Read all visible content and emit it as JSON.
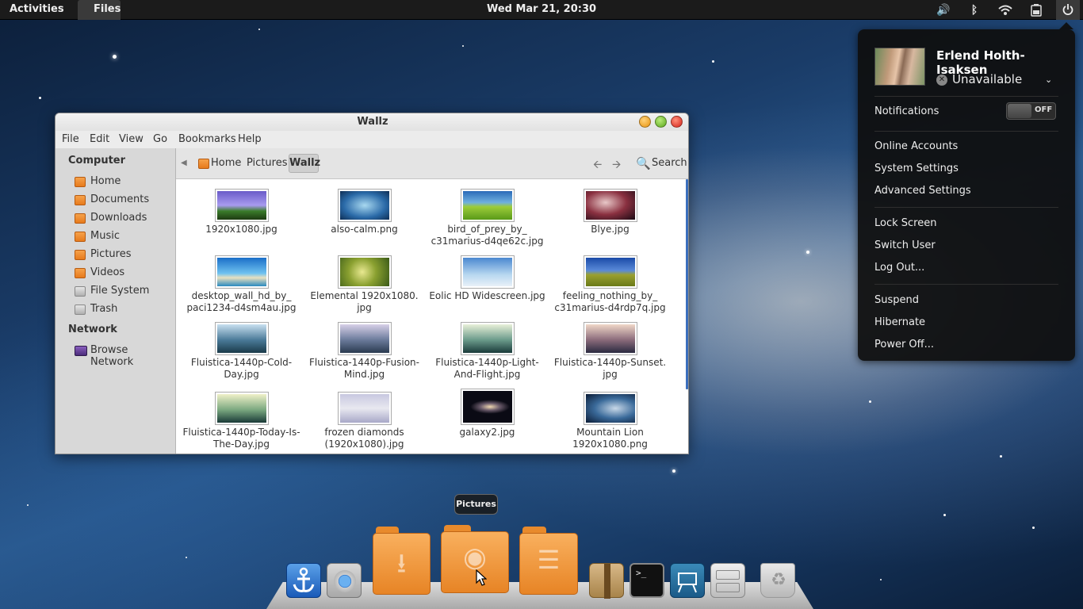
{
  "topbar": {
    "activities": "Activities",
    "app_menu": "Files",
    "clock": "Wed Mar 21, 20:30",
    "tray_icons": [
      "volume-icon",
      "bluetooth-icon",
      "wifi-icon",
      "battery-icon",
      "power-icon"
    ]
  },
  "user_menu": {
    "name": "Erlend Holth-Isaksen",
    "status": "Unavailable",
    "notifications_label": "Notifications",
    "notifications_state": "OFF",
    "items": [
      "Online Accounts",
      "System Settings",
      "Advanced Settings",
      "Lock Screen",
      "Switch User",
      "Log Out...",
      "Suspend",
      "Hibernate",
      "Power Off..."
    ]
  },
  "window": {
    "title": "Wallz",
    "menu": [
      "File",
      "Edit",
      "View",
      "Go",
      "Bookmarks",
      "Help"
    ],
    "sidebar": {
      "computer_heading": "Computer",
      "computer_items": [
        "Home",
        "Documents",
        "Downloads",
        "Music",
        "Pictures",
        "Videos",
        "File System",
        "Trash"
      ],
      "network_heading": "Network",
      "network_items": [
        "Browse Network"
      ]
    },
    "breadcrumb": [
      "Home",
      "Pictures",
      "Wallz"
    ],
    "search_label": "Search",
    "files": [
      {
        "name": "1920x1080.jpg"
      },
      {
        "name": "also-calm.png"
      },
      {
        "name": "bird_of_prey_by_ c31marius-d4qe62c.jpg"
      },
      {
        "name": "Blye.jpg"
      },
      {
        "name": "desktop_wall_hd_by_ paci1234-d4sm4au.jpg"
      },
      {
        "name": "Elemental 1920x1080. jpg"
      },
      {
        "name": "Eolic HD Widescreen.jpg"
      },
      {
        "name": "feeling_nothing_by_ c31marius-d4rdp7q.jpg"
      },
      {
        "name": "Fluistica-1440p-Cold- Day.jpg"
      },
      {
        "name": "Fluistica-1440p-Fusion- Mind.jpg"
      },
      {
        "name": "Fluistica-1440p-Light- And-Flight.jpg"
      },
      {
        "name": "Fluistica-1440p-Sunset. jpg"
      },
      {
        "name": "Fluistica-1440p-Today-Is- The-Day.jpg"
      },
      {
        "name": "frozen diamonds (1920x1080).jpg"
      },
      {
        "name": "galaxy2.jpg"
      },
      {
        "name": "Mountain Lion 1920x1080.png"
      }
    ]
  },
  "dock": {
    "tooltip": "Pictures",
    "items": [
      "anchor-icon",
      "chrome-icon",
      "downloads-folder-icon",
      "pictures-folder-icon",
      "documents-folder-icon",
      "archive-icon",
      "terminal-icon",
      "sketch-icon",
      "file-cabinet-icon",
      "trash-icon"
    ]
  }
}
